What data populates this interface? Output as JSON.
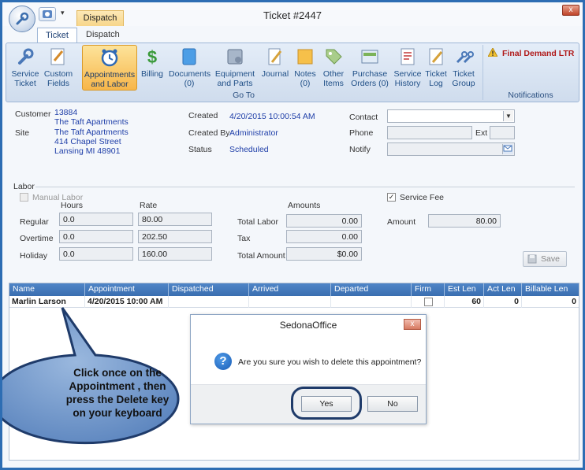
{
  "window": {
    "title": "Ticket #2447",
    "context_tab": "Dispatch",
    "close_glyph": "x"
  },
  "ribbon": {
    "tabs": [
      "Ticket",
      "Dispatch"
    ],
    "buttons": [
      {
        "label": "Service\nTicket",
        "icon": "wrench-icon"
      },
      {
        "label": "Custom\nFields",
        "icon": "custom-fields-icon"
      },
      {
        "label": "Appointments\nand Labor",
        "icon": "alarm-clock-icon"
      },
      {
        "label": "Billing",
        "icon": "dollar-icon"
      },
      {
        "label": "Documents\n(0)",
        "icon": "document-icon"
      },
      {
        "label": "Equipment\nand Parts",
        "icon": "equipment-icon"
      },
      {
        "label": "Journal",
        "icon": "journal-icon"
      },
      {
        "label": "Notes\n(0)",
        "icon": "note-icon"
      },
      {
        "label": "Other\nItems",
        "icon": "tag-icon"
      },
      {
        "label": "Purchase\nOrders (0)",
        "icon": "purchase-order-icon"
      },
      {
        "label": "Service\nHistory",
        "icon": "history-icon"
      },
      {
        "label": "Ticket\nLog",
        "icon": "log-icon"
      },
      {
        "label": "Ticket\nGroup",
        "icon": "group-icon"
      }
    ],
    "group_label": "Go To",
    "notifications": {
      "item": "Final Demand LTR",
      "label": "Notifications"
    }
  },
  "info": {
    "customer_label": "Customer",
    "customer_number": "13884",
    "customer_name": "The Taft Apartments",
    "site_label": "Site",
    "site_name": "The Taft Apartments",
    "site_street": "414 Chapel Street",
    "site_city": "Lansing MI 48901",
    "created_label": "Created",
    "created_value": "4/20/2015 10:00:54 AM",
    "created_by_label": "Created By",
    "created_by_value": "Administrator",
    "status_label": "Status",
    "status_value": "Scheduled",
    "contact_label": "Contact",
    "contact_value": "",
    "phone_label": "Phone",
    "phone_value": "",
    "ext_label": "Ext",
    "ext_value": "",
    "notify_label": "Notify",
    "notify_value": ""
  },
  "labor": {
    "section_label": "Labor",
    "manual_labor_label": "Manual Labor",
    "hours_header": "Hours",
    "rate_header": "Rate",
    "amounts_header": "Amounts",
    "regular_label": "Regular",
    "regular_hours": "0.0",
    "regular_rate": "80.00",
    "overtime_label": "Overtime",
    "overtime_hours": "0.0",
    "overtime_rate": "202.50",
    "holiday_label": "Holiday",
    "holiday_hours": "0.0",
    "holiday_rate": "160.00",
    "total_labor_label": "Total Labor",
    "total_labor_value": "0.00",
    "tax_label": "Tax",
    "tax_value": "0.00",
    "total_amount_label": "Total Amount",
    "total_amount_value": "$0.00",
    "service_fee_label": "Service Fee",
    "service_fee_checked": true,
    "amount_label": "Amount",
    "amount_value": "80.00",
    "save_label": "Save"
  },
  "grid": {
    "columns": [
      "Name",
      "Appointment",
      "Dispatched",
      "Arrived",
      "Departed",
      "Firm",
      "Est Len",
      "Act Len",
      "Billable Len"
    ],
    "rows": [
      {
        "name": "Marlin Larson",
        "appointment": "4/20/2015 10:00 AM",
        "dispatched": "",
        "arrived": "",
        "departed": "",
        "firm": false,
        "est_len": "60",
        "act_len": "0",
        "billable_len": "0"
      }
    ]
  },
  "dialog": {
    "title": "SedonaOffice",
    "message": "Are you sure you wish to delete this appointment?",
    "yes_label": "Yes",
    "no_label": "No",
    "icon": "question-icon"
  },
  "callout": {
    "line1": "Click once on the",
    "line2": "Appointment , then",
    "line3": "press the Delete key",
    "line4": "on your keyboard"
  },
  "colors": {
    "frame_border": "#2d6db3",
    "link_blue": "#1e3ea8",
    "grid_header": "#3a6eb0",
    "callout_fill": "#6c94c8",
    "callout_border": "#1f3b6a",
    "notification_red": "#b01a1a"
  }
}
